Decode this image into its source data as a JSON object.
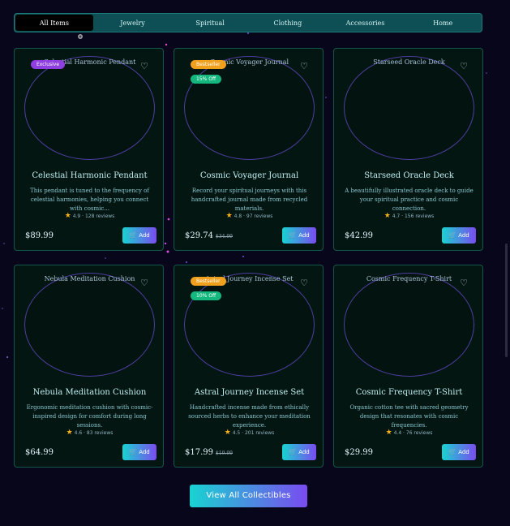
{
  "tabs": [
    {
      "label": "All Items",
      "active": true
    },
    {
      "label": "Jewelry"
    },
    {
      "label": "Spiritual"
    },
    {
      "label": "Clothing"
    },
    {
      "label": "Accessories"
    },
    {
      "label": "Home"
    }
  ],
  "products": [
    {
      "alt": "Celestial Harmonic Pendant",
      "badge": "Exclusive",
      "title": "Celestial Harmonic Pendant",
      "desc": "This pendant is tuned to the frequency of celestial harmonies, helping you connect with cosmic...",
      "rating": "4.9",
      "reviews": "128 reviews",
      "price": "$89.99"
    },
    {
      "alt": "Cosmic Voyager Journal",
      "badge": "Bestseller",
      "discount": "15% Off",
      "title": "Cosmic Voyager Journal",
      "desc": "Record your spiritual journeys with this handcrafted journal made from recycled materials.",
      "rating": "4.8",
      "reviews": "97 reviews",
      "price": "$29.74",
      "old_price": "$34.99"
    },
    {
      "alt": "Starseed Oracle Deck",
      "title": "Starseed Oracle Deck",
      "desc": "A beautifully illustrated oracle deck to guide your spiritual practice and cosmic connection.",
      "rating": "4.7",
      "reviews": "156 reviews",
      "price": "$42.99"
    },
    {
      "alt": "Nebula Meditation Cushion",
      "title": "Nebula Meditation Cushion",
      "desc": "Ergonomic meditation cushion with cosmic-inspired design for comfort during long sessions.",
      "rating": "4.6",
      "reviews": "83 reviews",
      "price": "$64.99"
    },
    {
      "alt": "Astral Journey Incense Set",
      "badge": "Bestseller",
      "discount": "10% Off",
      "title": "Astral Journey Incense Set",
      "desc": "Handcrafted incense made from ethically sourced herbs to enhance your meditation experience.",
      "rating": "4.5",
      "reviews": "201 reviews",
      "price": "$17.99",
      "old_price": "$19.99"
    },
    {
      "alt": "Cosmic Frequency T-Shirt",
      "title": "Cosmic Frequency T-Shirt",
      "desc": "Organic cotton tee with sacred geometry design that resonates with cosmic frequencies.",
      "rating": "4.4",
      "reviews": "76 reviews",
      "price": "$29.99"
    }
  ],
  "add_label": "Add",
  "view_all_label": "View All Collectibles",
  "colors": {
    "accent_cyan": "#18d3d1",
    "accent_purple": "#7a4bf0",
    "badge_exclusive": "#8f3fe0",
    "badge_bestseller": "#f0a01c",
    "badge_discount": "#14b87e"
  },
  "icons": {
    "favorite": "heart-icon",
    "cart": "cart-icon",
    "rating": "star-icon"
  }
}
